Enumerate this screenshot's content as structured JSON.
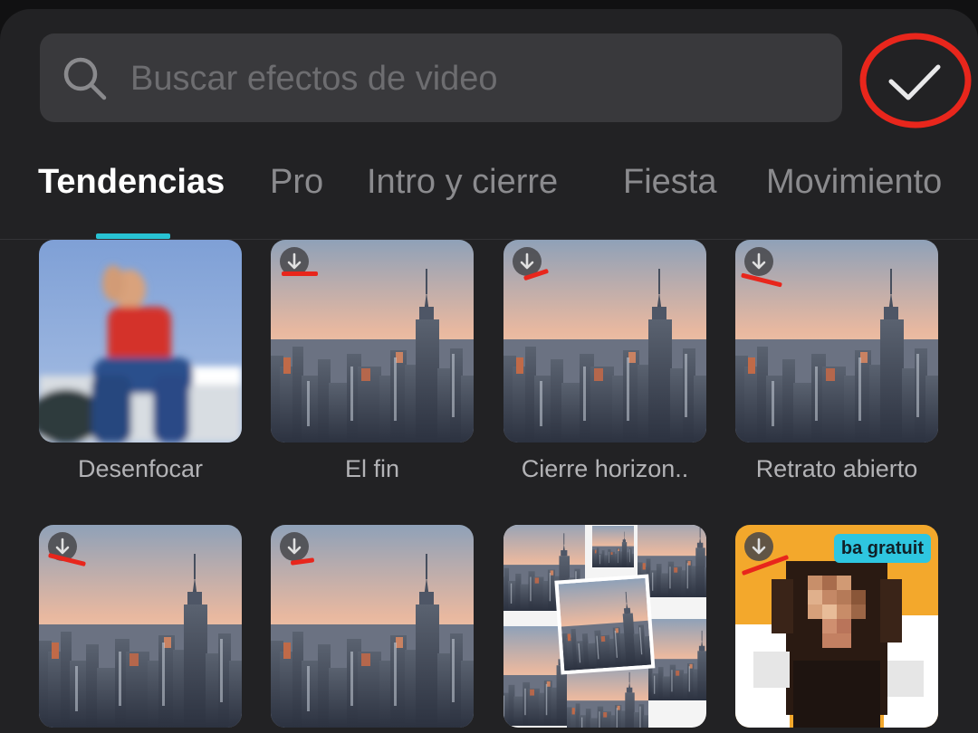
{
  "search": {
    "placeholder": "Buscar efectos de video",
    "value": ""
  },
  "tabs": [
    {
      "label": "Tendencias",
      "active": true
    },
    {
      "label": "Pro",
      "active": false
    },
    {
      "label": "Intro y cierre",
      "active": false
    },
    {
      "label": "Fiesta",
      "active": false
    },
    {
      "label": "Movimiento",
      "active": false
    }
  ],
  "effects": [
    {
      "label": "Desenfocar",
      "thumbnail": "blurred-person",
      "downloadable": false
    },
    {
      "label": "El fin",
      "thumbnail": "city-skyline",
      "downloadable": true
    },
    {
      "label": "Cierre horizon..",
      "thumbnail": "city-skyline",
      "downloadable": true
    },
    {
      "label": "Retrato abierto",
      "thumbnail": "city-skyline",
      "downloadable": true
    },
    {
      "label": "",
      "thumbnail": "city-skyline",
      "downloadable": true
    },
    {
      "label": "",
      "thumbnail": "city-skyline",
      "downloadable": true
    },
    {
      "label": "",
      "thumbnail": "city-collage",
      "downloadable": false
    },
    {
      "label": "",
      "thumbnail": "pixel-portrait",
      "downloadable": true,
      "badge": "ba gratuit"
    }
  ],
  "icons": {
    "search": "search-icon",
    "confirm": "checkmark-icon",
    "download": "download-arrow-icon"
  },
  "colors": {
    "background": "#222224",
    "search_field": "#39393c",
    "active_tab": "#ffffff",
    "inactive_tab": "#8b8b8e",
    "tab_indicator": "#28c3d4",
    "annotation": "#e8261c",
    "badge": "#2ec6e0"
  }
}
